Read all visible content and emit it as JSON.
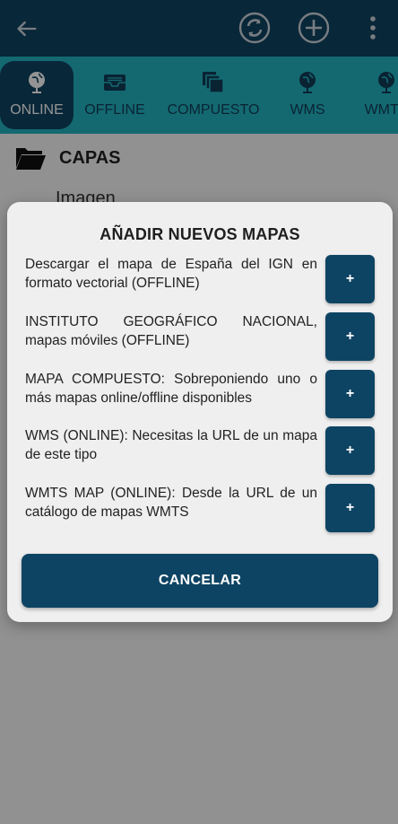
{
  "toolbar": {
    "back_icon": "arrow-left-icon",
    "sync_icon": "sync-icon",
    "add_icon": "plus-circle-icon",
    "more_icon": "more-vertical-icon"
  },
  "tabs": [
    {
      "label": "ONLINE",
      "icon": "globe-icon",
      "active": true
    },
    {
      "label": "OFFLINE",
      "icon": "inbox-icon",
      "active": false
    },
    {
      "label": "COMPUESTO",
      "icon": "layers-icon",
      "active": false
    },
    {
      "label": "WMS",
      "icon": "globe-icon",
      "active": false
    },
    {
      "label": "WMTS",
      "icon": "globe-icon",
      "active": false
    }
  ],
  "section": {
    "title": "CAPAS",
    "icon": "folder-open-icon"
  },
  "layers": [
    {
      "label": "Imagen"
    }
  ],
  "dialog": {
    "title": "AÑADIR NUEVOS MAPAS",
    "options": [
      {
        "text": "Descargar el mapa de España del IGN en formato vectorial (OFFLINE)",
        "button": "+"
      },
      {
        "text": "INSTITUTO GEOGRÁFICO NACIONAL, mapas móviles (OFFLINE)",
        "button": "+"
      },
      {
        "text": "MAPA COMPUESTO: Sobreponiendo uno o más mapas online/offline disponibles",
        "button": "+"
      },
      {
        "text": "WMS (ONLINE): Necesitas la URL de un mapa de este tipo",
        "button": "+"
      },
      {
        "text": "WMTS MAP (ONLINE): Desde la URL de un catálogo de mapas WMTS",
        "button": "+"
      }
    ],
    "cancel_label": "CANCELAR"
  },
  "colors": {
    "primary": "#0e4463",
    "accent": "#24b5c3",
    "dialog_bg": "#efefef"
  }
}
